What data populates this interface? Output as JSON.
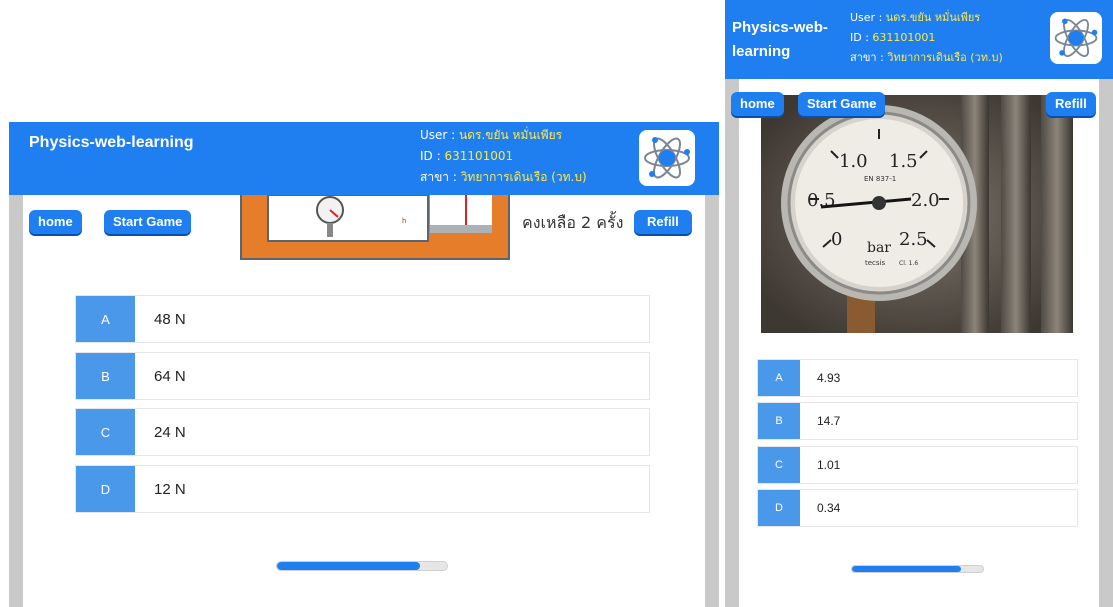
{
  "left": {
    "brand": "Physics-web-learning",
    "user_label": "User : ",
    "user_value": "นดร.ขยัน หมั่นเพียร",
    "id_label": "ID : ",
    "id_value": "631101001",
    "dept_label": "สาขา : ",
    "dept_value": "วิทยาการเดินเรือ (วท.บ)",
    "home_label": "home",
    "start_label": "Start Game",
    "remain_text": "คงเหลือ 2 ครั้ง",
    "refill_label": "Refill",
    "options": [
      {
        "letter": "A",
        "text": "48 N"
      },
      {
        "letter": "B",
        "text": "64 N"
      },
      {
        "letter": "C",
        "text": "24 N"
      },
      {
        "letter": "D",
        "text": "12 N"
      }
    ],
    "progress": 0.84
  },
  "right": {
    "brand": "Physics-web-learning",
    "user_label": "User : ",
    "user_value": "นดร.ขยัน หมั่นเพียร",
    "id_label": "ID : ",
    "id_value": "631101001",
    "dept_label": "สาขา : ",
    "dept_value": "วิทยาการเดินเรือ (วท.บ)",
    "home_label": "home",
    "start_label": "Start Game",
    "refill_label": "Refill",
    "gauge": {
      "scale": [
        "0",
        "0.5",
        "1.0",
        "1.5",
        "2.0",
        "2.5"
      ],
      "standard": "EN 837-1",
      "unit": "bar",
      "brand": "tecsis",
      "class": "Cl. 1.6"
    },
    "options": [
      {
        "letter": "A",
        "text": "4.93"
      },
      {
        "letter": "B",
        "text": "14.7"
      },
      {
        "letter": "C",
        "text": "1.01"
      },
      {
        "letter": "D",
        "text": "0.34"
      }
    ],
    "progress": 0.83
  },
  "colors": {
    "header_blue": "#1f7ff0",
    "option_blue": "#4a98ea",
    "user_yellow": "#ffe94a"
  },
  "icons": [
    "atom-logo-icon"
  ]
}
